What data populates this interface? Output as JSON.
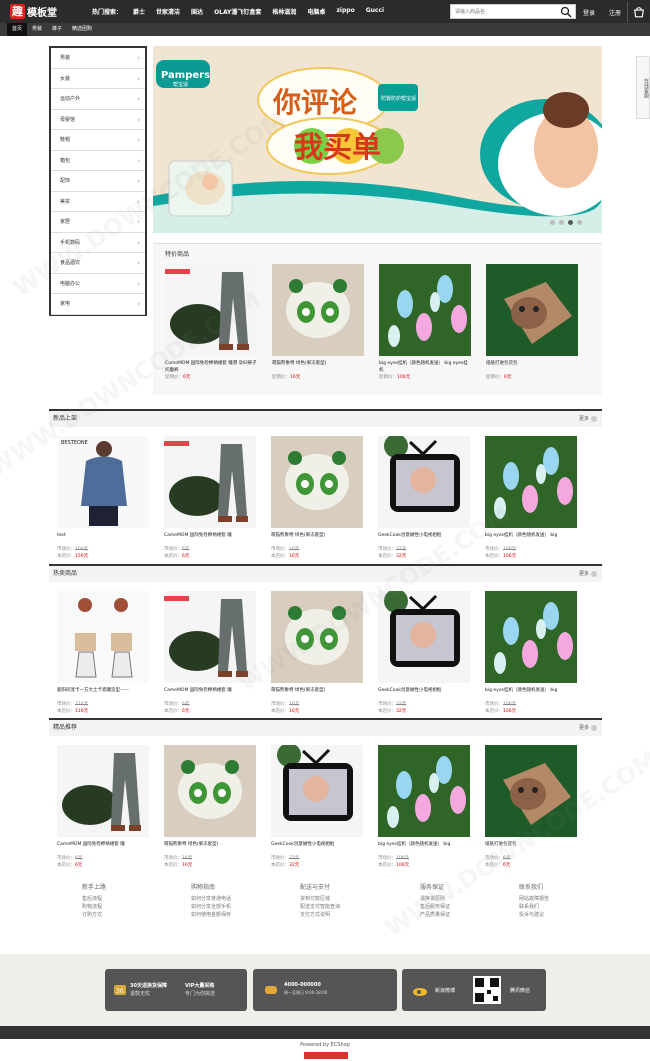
{
  "header": {
    "logo_mark": "趣",
    "logo_text": "模板堂",
    "hot_label": "热门搜索：",
    "hot_items": [
      "爵士",
      "世家清洁",
      "国达",
      "OLAY潘飞钉盒套",
      "格林滋润",
      "电脑桌",
      "zippo",
      "Gucci"
    ],
    "search_placeholder": "请输入商品名",
    "login": "登录",
    "register": "注册"
  },
  "nav": [
    "首页",
    "男装",
    "裤子",
    "精选团购"
  ],
  "sidebar": [
    "男装",
    "女装",
    "运动户外",
    "母婴馆",
    "鞋帽",
    "箱包",
    "配饰",
    "美妆",
    "家居",
    "手机数码",
    "食品酒饮",
    "电脑办公",
    "家电"
  ],
  "banner": {
    "brand": "Pampers",
    "brand_cn": "帮宝适",
    "headline": "你评论",
    "subline": "我买单",
    "badge": "防臀防护帮宝适"
  },
  "special": {
    "title": "特价商品",
    "items": [
      {
        "name": "CameMOM 国际免检棉柄裙套 瞳港 孕妇裤子 托腹裤",
        "price_label": "促销价：",
        "price": "6元",
        "img": "pants"
      },
      {
        "name": "萌猫熊象特 绿色(果冻套型)",
        "price_label": "促销价：",
        "price": "16元",
        "img": "panda"
      },
      {
        "name": "big eyes挂机（颜色随机发送） big eyes挂机",
        "price_label": "促销价：",
        "price": "106元",
        "img": "rabbits"
      },
      {
        "name": "纸纸打进包货包",
        "price_label": "促销价：",
        "price": "6元",
        "img": "monkey"
      }
    ]
  },
  "new_products": {
    "title": "新品上架",
    "more": "更多",
    "items": [
      {
        "name": "test",
        "market": "市场价：",
        "market_price": "100元",
        "shop": "本店价：",
        "price": "156元",
        "img": "shirt"
      },
      {
        "name": "CameMOM 国际免检棉柄裙套 瞳",
        "market": "市场价：",
        "market_price": "6元",
        "shop": "本店价：",
        "price": "6元",
        "img": "pants"
      },
      {
        "name": "萌猫熊象特 绿色(果冻套型)",
        "market": "市场价：",
        "market_price": "16元",
        "shop": "本店价：",
        "price": "16元",
        "img": "panda"
      },
      {
        "name": "GeekCook创意磁性小电视相框",
        "market": "市场价：",
        "market_price": "32元",
        "shop": "本店价：",
        "price": "32元",
        "img": "tv"
      },
      {
        "name": "big eyes挂机（颜色随机发送） big",
        "market": "市场价：",
        "market_price": "106元",
        "shop": "本店价：",
        "price": "106元",
        "img": "rabbits"
      }
    ]
  },
  "hot_products": {
    "title": "热卖商品",
    "more": "更多",
    "items": [
      {
        "name": "鹿阳同宠卡一方大土卡瓷罐造型——",
        "market": "市场价：",
        "market_price": "116元",
        "shop": "本店价：",
        "price": "116元",
        "img": "hangers"
      },
      {
        "name": "CameMOM 国际免检棉柄裙套 瞳",
        "market": "市场价：",
        "market_price": "6元",
        "shop": "本店价：",
        "price": "6元",
        "img": "pants"
      },
      {
        "name": "萌猫熊象特 绿色(果冻套型)",
        "market": "市场价：",
        "market_price": "16元",
        "shop": "本店价：",
        "price": "16元",
        "img": "panda"
      },
      {
        "name": "GeekCook创意磁性小电视相框",
        "market": "市场价：",
        "market_price": "32元",
        "shop": "本店价：",
        "price": "32元",
        "img": "tv"
      },
      {
        "name": "big eyes挂机（颜色随机发送） big",
        "market": "市场价：",
        "market_price": "106元",
        "shop": "本店价：",
        "price": "106元",
        "img": "rabbits"
      }
    ]
  },
  "recommend": {
    "title": "精品推荐",
    "more": "更多",
    "items": [
      {
        "name": "CameMOM 国际免检棉柄裙套 瞳",
        "market": "市场价：",
        "market_price": "6元",
        "shop": "本店价：",
        "price": "6元",
        "img": "pants"
      },
      {
        "name": "萌猫熊象特 绿色(果冻套型)",
        "market": "市场价：",
        "market_price": "16元",
        "shop": "本店价：",
        "price": "16元",
        "img": "panda"
      },
      {
        "name": "GeekCook创意磁性小电视相框",
        "market": "市场价：",
        "market_price": "32元",
        "shop": "本店价：",
        "price": "32元",
        "img": "tv"
      },
      {
        "name": "big eyes挂机（颜色随机发送） big",
        "market": "市场价：",
        "market_price": "106元",
        "shop": "本店价：",
        "price": "106元",
        "img": "rabbits"
      },
      {
        "name": "纸纸打进包货包",
        "market": "市场价：",
        "market_price": "6元",
        "shop": "本店价：",
        "price": "6元",
        "img": "monkey"
      }
    ]
  },
  "footer": [
    {
      "title": "新手上路",
      "links": [
        "售后流程",
        "购物流程",
        "订购方式"
      ]
    },
    {
      "title": "购物指南",
      "links": [
        "如何分享普通电话",
        "如何分享全部手机",
        "如何使用金额保存"
      ]
    },
    {
      "title": "配送与支付",
      "links": [
        "货到付款区域",
        "配送支付智能查询",
        "支付方式说明"
      ]
    },
    {
      "title": "服务保证",
      "links": [
        "退换货原则",
        "售后服务保证",
        "产品质量保证"
      ]
    },
    {
      "title": "联系我们",
      "links": [
        "网站故障报告",
        "联系我们",
        "投诉与建议"
      ]
    }
  ],
  "services": {
    "guarantee": "30天退换货保障",
    "guarantee_sub": "退款无忧",
    "vip": "VIP大量采购",
    "vip_sub": "专门为你挑选",
    "phone": "4000-000000",
    "phone_sub": "周一至周日 9:00-18:00",
    "weibo": "新浪微博",
    "wechat": "腾讯微信"
  },
  "powered": "Powered by ECShop",
  "side_float": "在线客服"
}
